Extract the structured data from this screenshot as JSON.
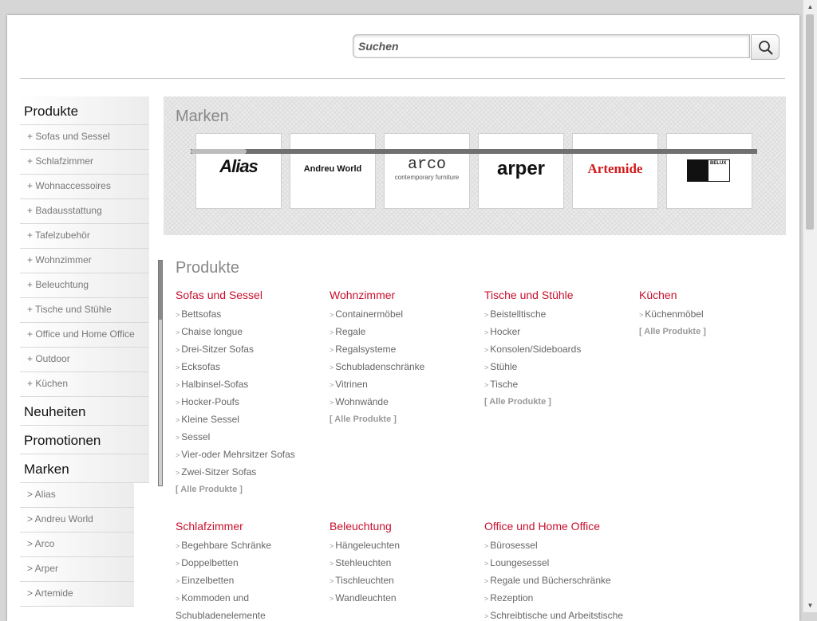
{
  "search": {
    "placeholder": "Suchen"
  },
  "sidebar": {
    "produkte": {
      "title": "Produkte",
      "items": [
        "+ Sofas und Sessel",
        "+ Schlafzimmer",
        "+ Wohnaccessoires",
        "+ Badausstattung",
        "+ Tafelzubehör",
        "+ Wohnzimmer",
        "+ Beleuchtung",
        "+ Tische und Stühle",
        "+ Office und Home Office",
        "+ Outdoor",
        "+ Küchen"
      ]
    },
    "neuheiten": "Neuheiten",
    "promotionen": "Promotionen",
    "marken": {
      "title": "Marken",
      "items": [
        "> Alias",
        "> Andreu World",
        "> Arco",
        "> Arper",
        "> Artemide"
      ]
    }
  },
  "brands": {
    "title": "Marken",
    "logos": [
      {
        "name": "Alias",
        "text": "Alias"
      },
      {
        "name": "Andreu World",
        "text": "Andreu World"
      },
      {
        "name": "Arco",
        "text": "arco",
        "tagline": "contemporary furniture"
      },
      {
        "name": "Arper",
        "text": "arper"
      },
      {
        "name": "Artemide",
        "text": "Artemide"
      },
      {
        "name": "Belux",
        "text": "BELUX"
      }
    ]
  },
  "products": {
    "title": "Produkte",
    "all_label": "[ Alle Produkte ]",
    "categories": [
      {
        "title": "Sofas und Sessel",
        "items": [
          "Bettsofas",
          "Chaise longue",
          "Drei-Sitzer Sofas",
          "Ecksofas",
          "Halbinsel-Sofas",
          "Hocker-Poufs",
          "Kleine Sessel",
          "Sessel",
          "Vier-oder Mehrsitzer Sofas",
          "Zwei-Sitzer Sofas"
        ]
      },
      {
        "title": "Wohnzimmer",
        "items": [
          "Containermöbel",
          "Regale",
          "Regalsysteme",
          "Schubladenschränke",
          "Vitrinen",
          "Wohnwände"
        ]
      },
      {
        "title": "Tische und Stühle",
        "items": [
          "Beistelltische",
          "Hocker",
          "Konsolen/Sideboards",
          "Stühle",
          "Tische"
        ]
      },
      {
        "title": "Küchen",
        "items": [
          "Küchenmöbel"
        ]
      },
      {
        "title": "Schlafzimmer",
        "items": [
          "Begehbare Schränke",
          "Doppelbetten",
          "Einzelbetten",
          "Kommoden und",
          "Schubladenelemente"
        ]
      },
      {
        "title": "Beleuchtung",
        "items": [
          "Hängeleuchten",
          "Stehleuchten",
          "Tischleuchten",
          "Wandleuchten"
        ]
      },
      {
        "title": "Office und Home Office",
        "items": [
          "Bürosessel",
          "Loungesessel",
          "Regale und Bücherschränke",
          "Rezeption",
          "Schreibtische und Arbeitstische"
        ]
      }
    ]
  },
  "colors": {
    "accent": "#c8102e",
    "text": "#666666",
    "muted": "#888888"
  }
}
